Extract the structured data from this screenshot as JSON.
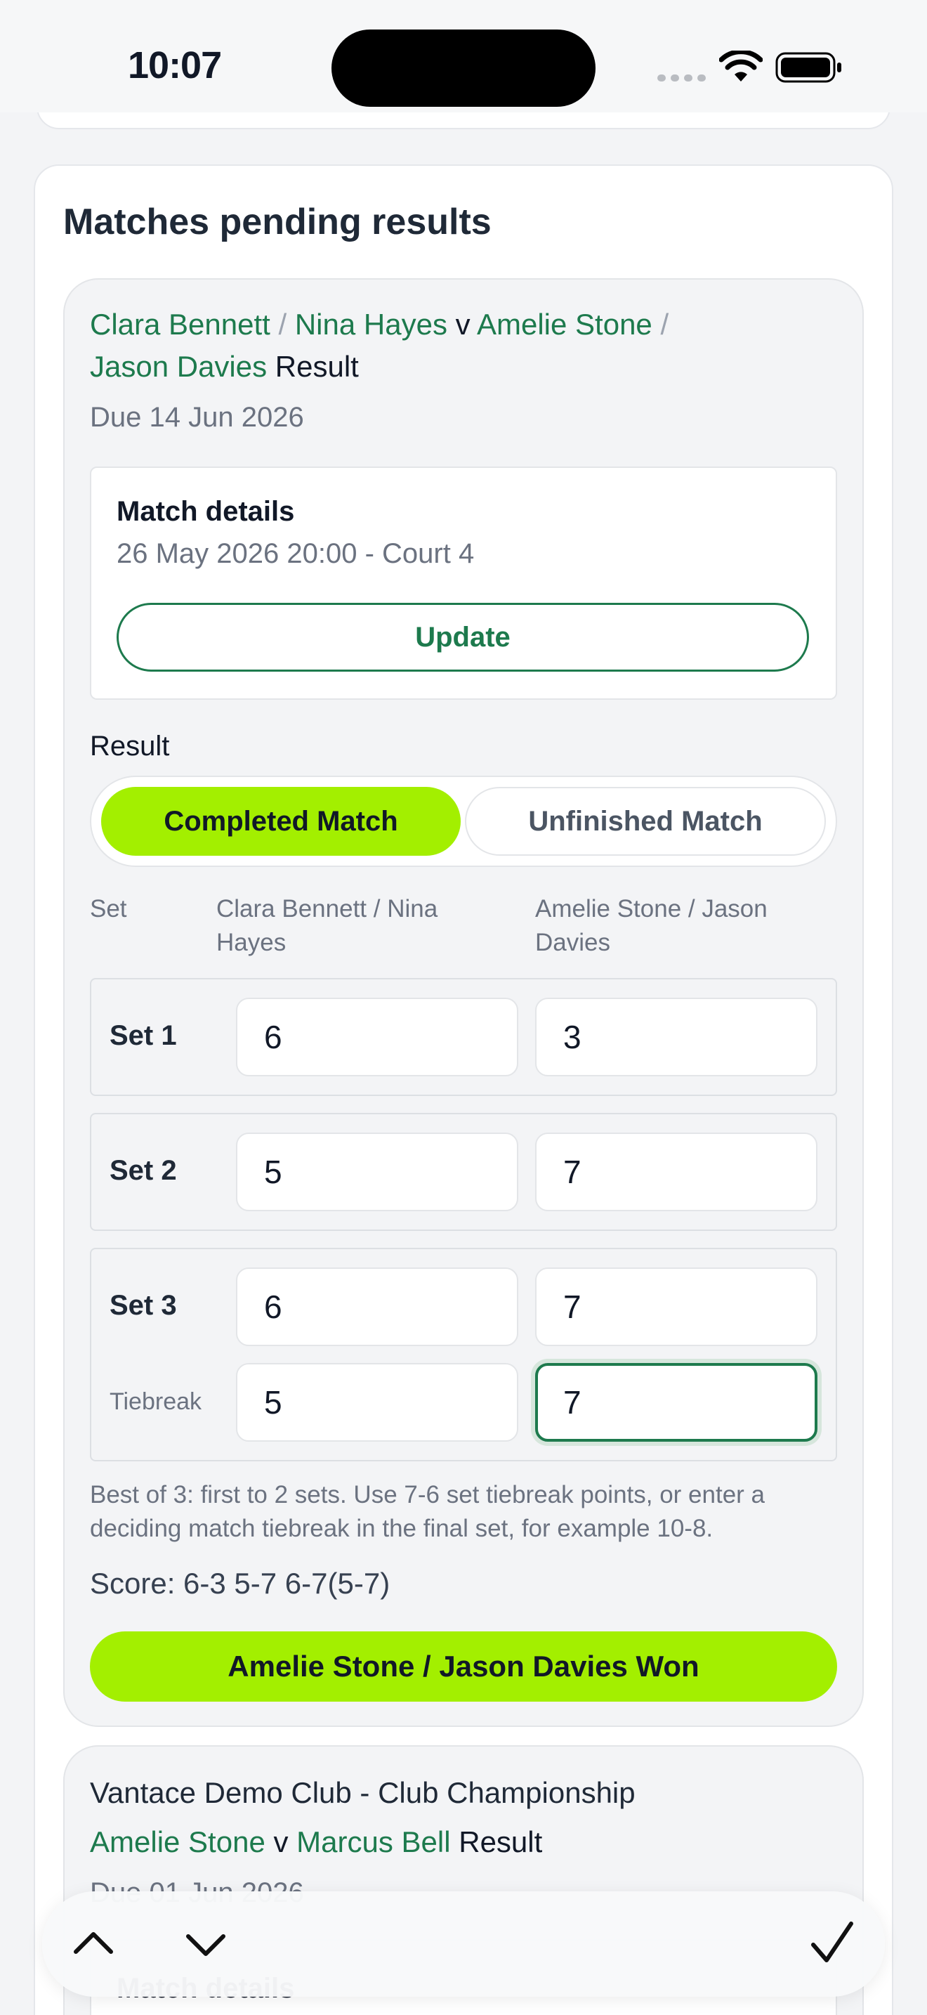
{
  "status_bar": {
    "time": "10:07"
  },
  "section": {
    "title": "Matches pending results"
  },
  "match": {
    "team1": {
      "player1": "Clara Bennett",
      "player2": "Nina Hayes"
    },
    "team2": {
      "player1": "Amelie Stone",
      "player2": "Jason Davies"
    },
    "separator": "/",
    "versus": "v",
    "result_word": "Result",
    "due": "Due 14 Jun 2026",
    "details": {
      "title": "Match details",
      "datetime_court": "26 May 2026 20:00 - Court 4",
      "update_label": "Update"
    },
    "result_label": "Result",
    "mode_options": [
      "Completed Match",
      "Unfinished Match"
    ],
    "selected_mode": "Completed Match",
    "columns": {
      "set": "Set",
      "team1": "Clara Bennett / Nina Hayes",
      "team2": "Amelie Stone / Jason Davies"
    },
    "sets": [
      {
        "label": "Set 1",
        "team1": "6",
        "team2": "3"
      },
      {
        "label": "Set 2",
        "team1": "5",
        "team2": "7"
      },
      {
        "label": "Set 3",
        "team1": "6",
        "team2": "7"
      }
    ],
    "tiebreak": {
      "label": "Tiebreak",
      "team1": "5",
      "team2": "7"
    },
    "hint": "Best of 3: first to 2 sets. Use 7-6 set tiebreak points, or enter a deciding match tiebreak in the final set, for example 10-8.",
    "score": "Score: 6-3 5-7 6-7(5-7)",
    "winner_label": "Amelie Stone / Jason Davies Won"
  },
  "next_match": {
    "competition": "Vantace Demo Club - Club Championship",
    "player1": "Amelie Stone",
    "versus": "v",
    "player2": "Marcus Bell",
    "result_word": "Result",
    "due": "Due 01 Jun 2026",
    "details_title": "Match details"
  },
  "keyboard_toolbar": {
    "icons": [
      "chevron-up-icon",
      "chevron-down-icon",
      "checkmark-icon"
    ]
  },
  "colors": {
    "accent_green": "#1d7a4d",
    "lime": "#a3ef00",
    "muted_text": "#6b7280"
  }
}
